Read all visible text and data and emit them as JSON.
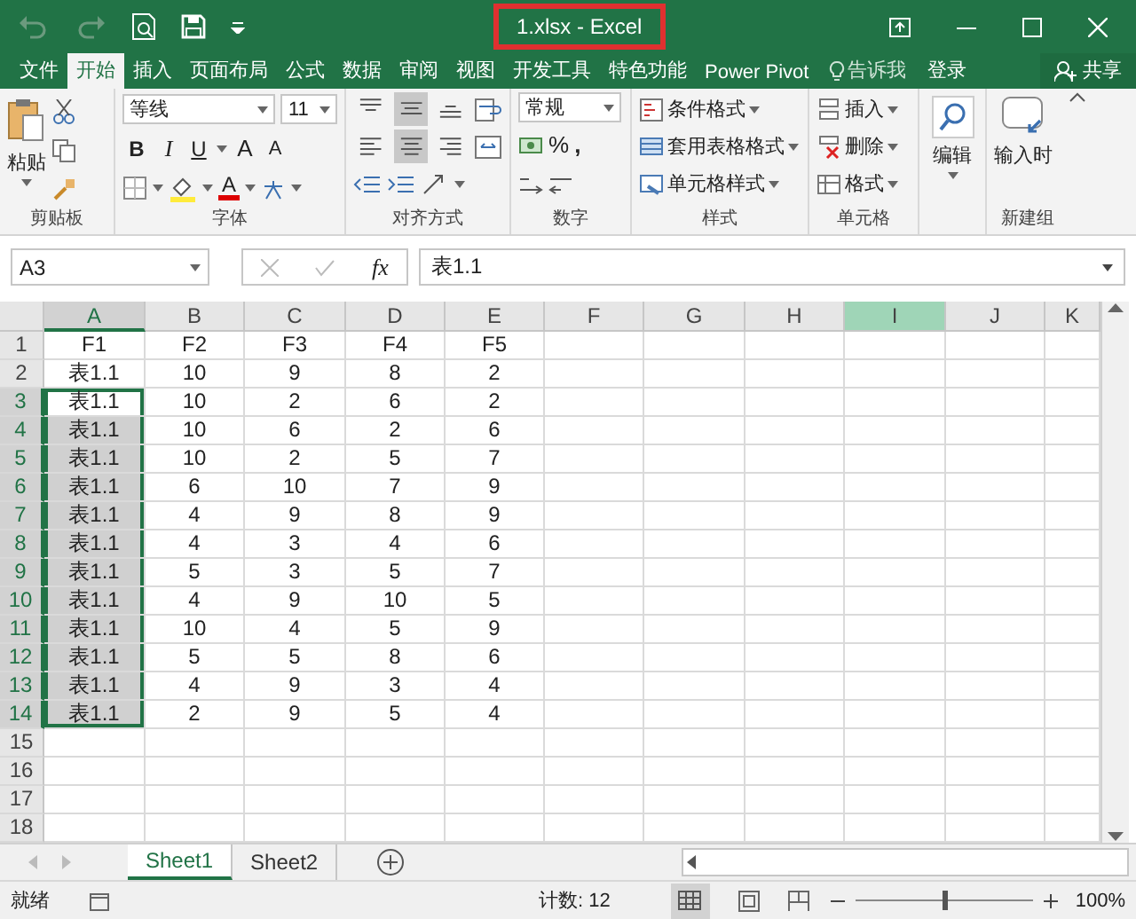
{
  "title_bar": {
    "title": "1.xlsx - Excel"
  },
  "ribbon_tabs": [
    {
      "label": "文件",
      "selected": false
    },
    {
      "label": "开始",
      "selected": true
    },
    {
      "label": "插入",
      "selected": false
    },
    {
      "label": "页面布局",
      "selected": false
    },
    {
      "label": "公式",
      "selected": false
    },
    {
      "label": "数据",
      "selected": false
    },
    {
      "label": "审阅",
      "selected": false
    },
    {
      "label": "视图",
      "selected": false
    },
    {
      "label": "开发工具",
      "selected": false
    },
    {
      "label": "特色功能",
      "selected": false
    },
    {
      "label": "Power Pivot",
      "selected": false
    }
  ],
  "tell_me": "告诉我",
  "sign_in": "登录",
  "share": "共享",
  "ribbon": {
    "clipboard": {
      "label": "剪贴板",
      "paste": "粘贴"
    },
    "font": {
      "label": "字体",
      "font_name": "等线",
      "font_size": "11",
      "bold": "B",
      "italic": "I",
      "underline": "U",
      "grow": "A",
      "shrink": "A",
      "font_color": "A"
    },
    "alignment": {
      "label": "对齐方式",
      "buttons": [
        {
          "kind": "top",
          "selected": false
        },
        {
          "kind": "middle",
          "selected": true
        },
        {
          "kind": "bottom",
          "selected": false
        },
        {
          "kind": "left",
          "selected": false
        },
        {
          "kind": "center",
          "selected": true
        },
        {
          "kind": "right",
          "selected": false
        }
      ]
    },
    "number": {
      "label": "数字",
      "format": "常规",
      "percent": "%",
      "comma": ","
    },
    "styles": {
      "label": "样式",
      "items": [
        "条件格式",
        "套用表格格式",
        "单元格样式"
      ]
    },
    "cells": {
      "label": "单元格",
      "items": [
        "插入",
        "删除",
        "格式"
      ]
    },
    "editing": {
      "label": "编辑"
    },
    "new_group": {
      "label": "新建组",
      "button": "输入时"
    }
  },
  "formula_bar": {
    "name_box": "A3",
    "fx": "fx",
    "formula": "表1.1"
  },
  "sheet": {
    "columns": [
      {
        "label": "A",
        "selected": true,
        "highlighted": false
      },
      {
        "label": "B",
        "selected": false,
        "highlighted": false
      },
      {
        "label": "C",
        "selected": false,
        "highlighted": false
      },
      {
        "label": "D",
        "selected": false,
        "highlighted": false
      },
      {
        "label": "E",
        "selected": false,
        "highlighted": false
      },
      {
        "label": "F",
        "selected": false,
        "highlighted": false
      },
      {
        "label": "G",
        "selected": false,
        "highlighted": false
      },
      {
        "label": "H",
        "selected": false,
        "highlighted": false
      },
      {
        "label": "I",
        "selected": false,
        "highlighted": true
      },
      {
        "label": "J",
        "selected": false,
        "highlighted": false
      },
      {
        "label": "K",
        "selected": false,
        "highlighted": false
      }
    ],
    "rows": [
      {
        "number": "1",
        "selected": false,
        "active": false,
        "cells": [
          "F1",
          "F2",
          "F3",
          "F4",
          "F5"
        ]
      },
      {
        "number": "2",
        "selected": false,
        "active": false,
        "cells": [
          "表1.1",
          "10",
          "9",
          "8",
          "2"
        ]
      },
      {
        "number": "3",
        "selected": true,
        "active": true,
        "cells": [
          "表1.1",
          "10",
          "2",
          "6",
          "2"
        ]
      },
      {
        "number": "4",
        "selected": true,
        "active": false,
        "cells": [
          "表1.1",
          "10",
          "6",
          "2",
          "6"
        ]
      },
      {
        "number": "5",
        "selected": true,
        "active": false,
        "cells": [
          "表1.1",
          "10",
          "2",
          "5",
          "7"
        ]
      },
      {
        "number": "6",
        "selected": true,
        "active": false,
        "cells": [
          "表1.1",
          "6",
          "10",
          "7",
          "9"
        ]
      },
      {
        "number": "7",
        "selected": true,
        "active": false,
        "cells": [
          "表1.1",
          "4",
          "9",
          "8",
          "9"
        ]
      },
      {
        "number": "8",
        "selected": true,
        "active": false,
        "cells": [
          "表1.1",
          "4",
          "3",
          "4",
          "6"
        ]
      },
      {
        "number": "9",
        "selected": true,
        "active": false,
        "cells": [
          "表1.1",
          "5",
          "3",
          "5",
          "7"
        ]
      },
      {
        "number": "10",
        "selected": true,
        "active": false,
        "cells": [
          "表1.1",
          "4",
          "9",
          "10",
          "5"
        ]
      },
      {
        "number": "11",
        "selected": true,
        "active": false,
        "cells": [
          "表1.1",
          "10",
          "4",
          "5",
          "9"
        ]
      },
      {
        "number": "12",
        "selected": true,
        "active": false,
        "cells": [
          "表1.1",
          "5",
          "5",
          "8",
          "6"
        ]
      },
      {
        "number": "13",
        "selected": true,
        "active": false,
        "cells": [
          "表1.1",
          "4",
          "9",
          "3",
          "4"
        ]
      },
      {
        "number": "14",
        "selected": true,
        "active": false,
        "cells": [
          "表1.1",
          "2",
          "9",
          "5",
          "4"
        ]
      },
      {
        "number": "15",
        "selected": false,
        "active": false,
        "cells": []
      },
      {
        "number": "16",
        "selected": false,
        "active": false,
        "cells": []
      },
      {
        "number": "17",
        "selected": false,
        "active": false,
        "cells": []
      },
      {
        "number": "18",
        "selected": false,
        "active": false,
        "cells": []
      }
    ]
  },
  "sheet_tabs": [
    {
      "label": "Sheet1",
      "selected": true
    },
    {
      "label": "Sheet2",
      "selected": false
    }
  ],
  "status_bar": {
    "status": "就绪",
    "count": "计数: 12",
    "zoom_slider": {
      "level": 0.5
    },
    "zoom": "100%"
  }
}
